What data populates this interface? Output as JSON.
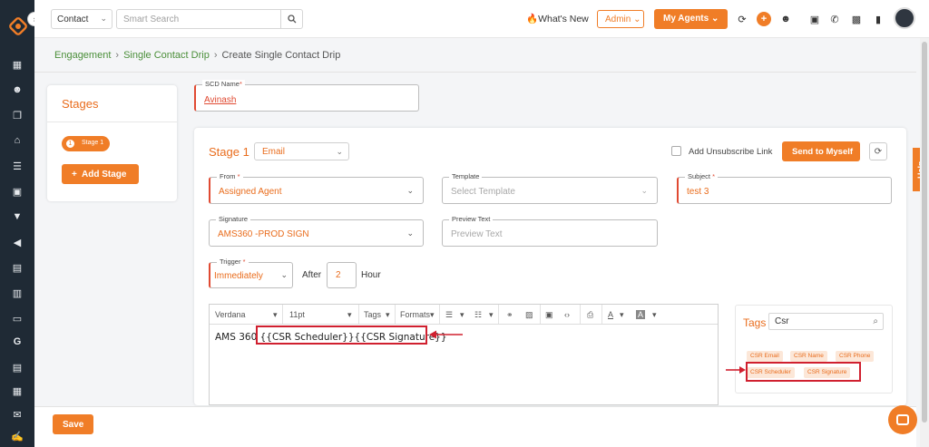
{
  "topbar": {
    "contact_select": "Contact",
    "search_placeholder": "Smart Search",
    "whats_new": "What's New",
    "admin": "Admin",
    "my_agents": "My Agents"
  },
  "breadcrumb": {
    "engagement": "Engagement",
    "single_contact_drip": "Single Contact Drip",
    "current": "Create Single Contact Drip"
  },
  "stages_panel": {
    "title": "Stages",
    "stage_number": "1",
    "stage_label": "Stage 1",
    "add_stage": "Add Stage"
  },
  "scd_name": {
    "label": "SCD Name",
    "value": "Avinash"
  },
  "stage": {
    "title": "Stage 1",
    "channel": "Email",
    "unsubscribe_label": "Add Unsubscribe Link",
    "send_to_myself": "Send to Myself"
  },
  "fields": {
    "from_label": "From",
    "from_value": "Assigned Agent",
    "template_label": "Template",
    "template_placeholder": "Select Template",
    "subject_label": "Subject",
    "subject_value": "test 3",
    "signature_label": "Signature",
    "signature_value": "AMS360 -PROD SIGN",
    "preview_label": "Preview Text",
    "preview_placeholder": "Preview Text",
    "trigger_label": "Trigger",
    "trigger_value": "Immediately",
    "after_label": "After",
    "after_value": "2",
    "hour_label": "Hour"
  },
  "editor": {
    "font": "Verdana",
    "size": "11pt",
    "tags_menu": "Tags",
    "formats_menu": "Formats",
    "content": "AMS 360 {{CSR Scheduler}}{{CSR Signature}}"
  },
  "tags_panel": {
    "title": "Tags",
    "search_value": "Csr",
    "items": [
      "CSR Email",
      "CSR Name",
      "CSR Phone",
      "CSR Scheduler",
      "CSR Signature"
    ]
  },
  "footer": {
    "save": "Save",
    "help": "Help"
  },
  "colors": {
    "brand_orange": "#f07d27",
    "nav_dark": "#1f2a35",
    "highlight_red": "#d0202f",
    "link_green": "#4b8f3a"
  }
}
